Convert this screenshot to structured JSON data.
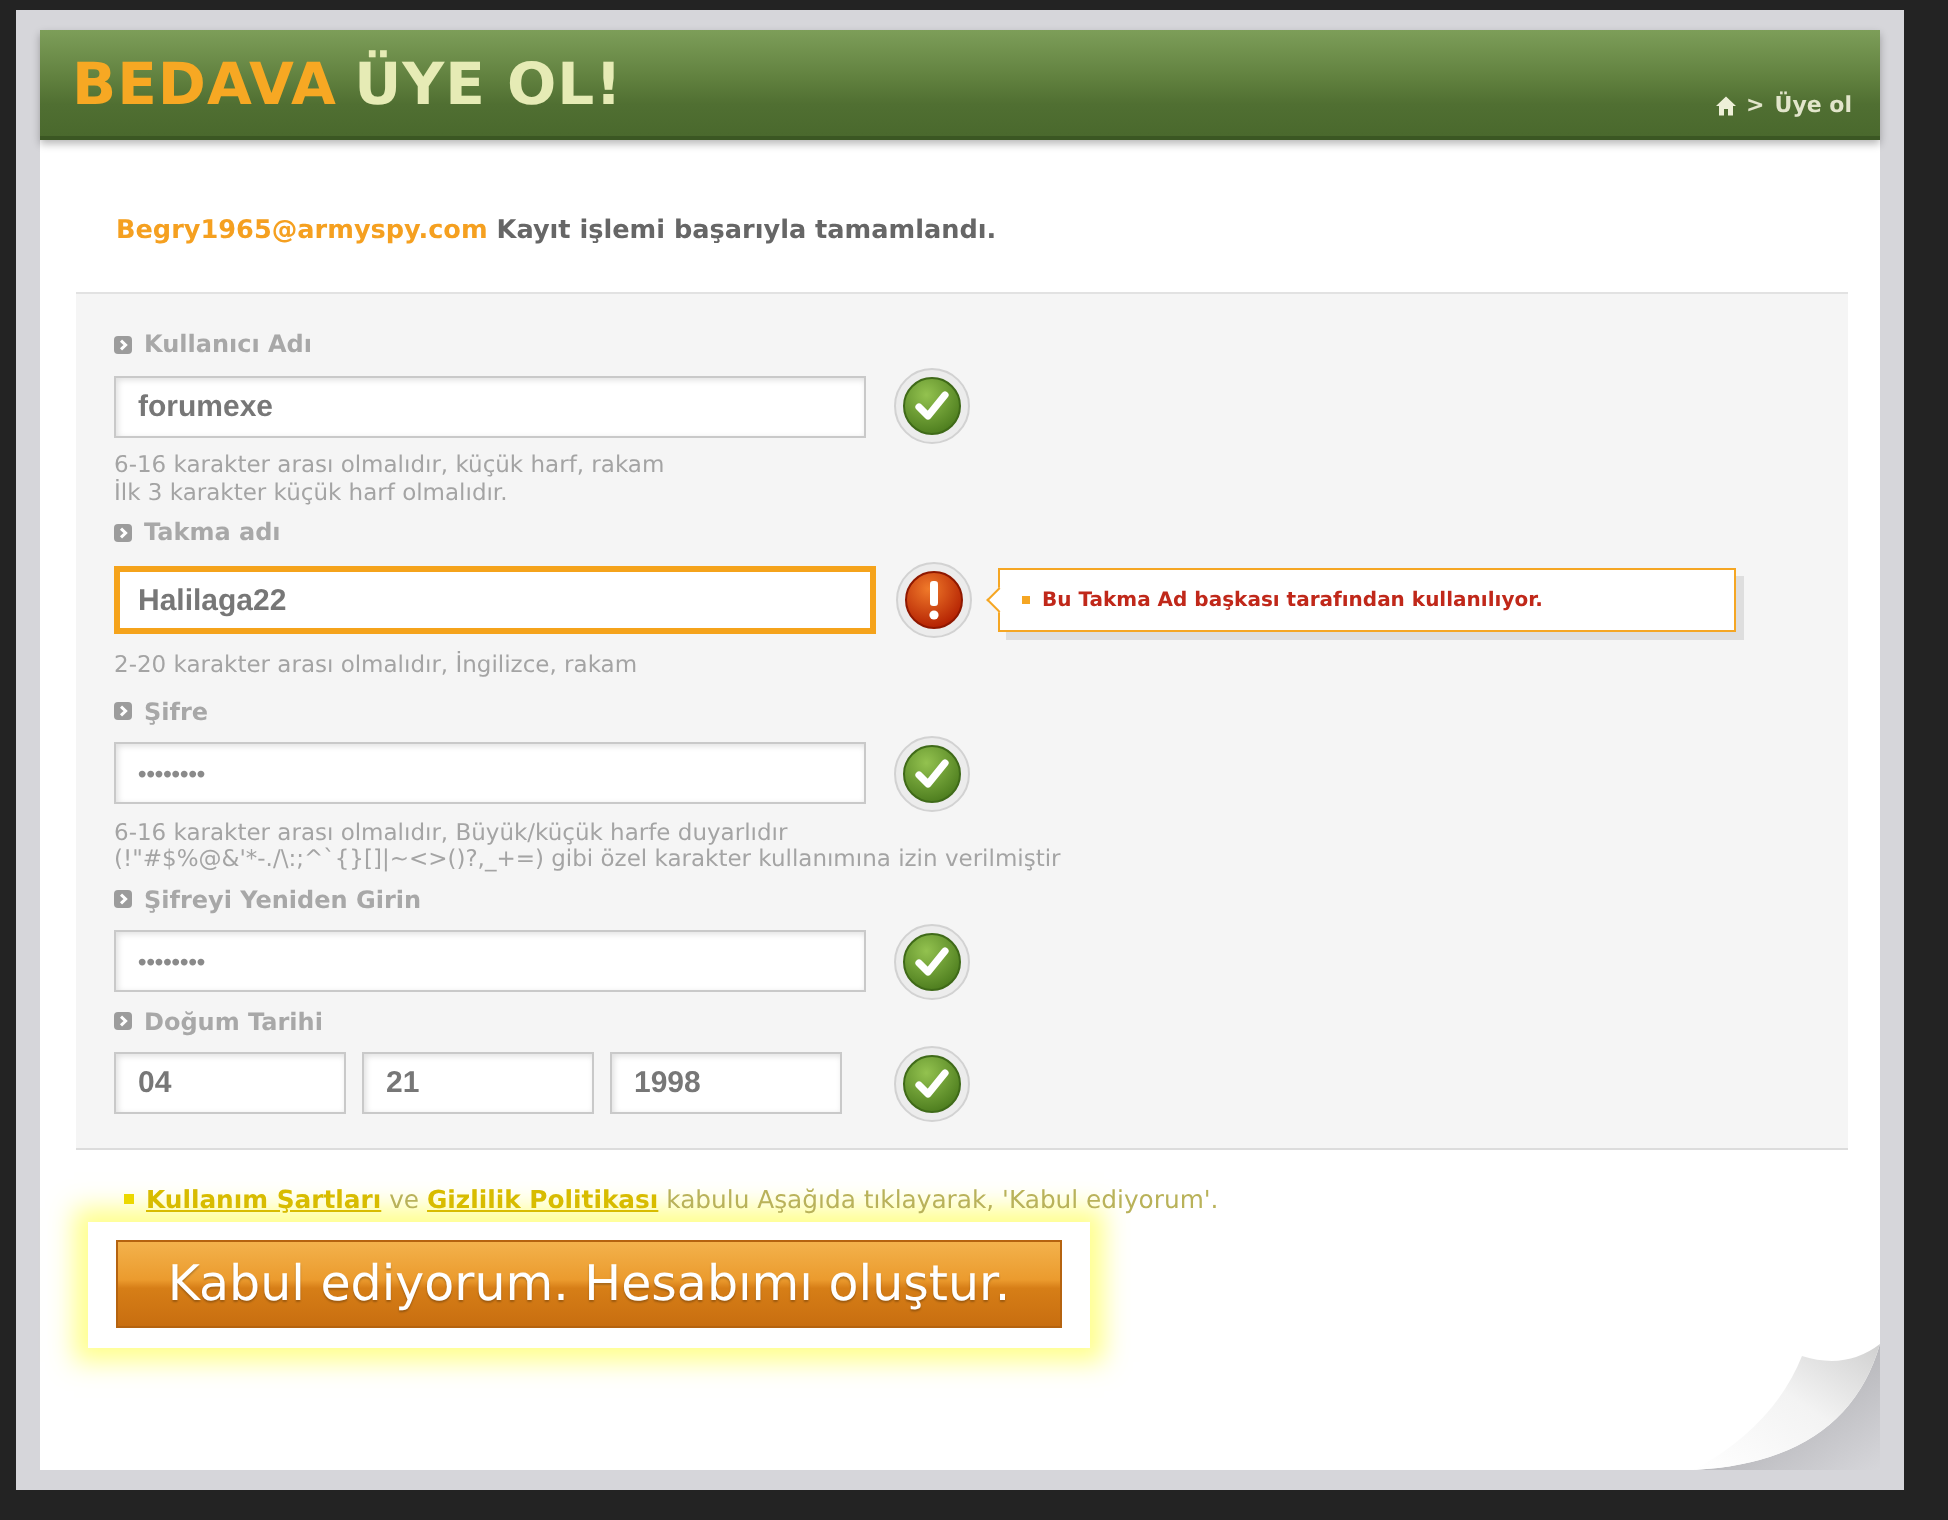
{
  "header": {
    "title": [
      {
        "text": "BEDAVA",
        "kind": "accent"
      },
      {
        "text": "ÜYE OL!",
        "kind": "plain"
      }
    ],
    "breadcrumb": {
      "separator": ">",
      "current": "Üye ol"
    }
  },
  "notice": {
    "email": "Begry1965@armyspy.com",
    "message": "Kayıt işlemi başarıyla tamamlandı."
  },
  "fields": [
    {
      "kind": "text",
      "label": "Kullanıcı Adı",
      "value": "forumexe",
      "valid": true,
      "hints": [
        "6-16 karakter arası olmalıdır, küçük harf, rakam",
        "İlk 3 karakter küçük harf olmalıdır."
      ]
    },
    {
      "kind": "text",
      "label": "Takma adı",
      "value": "Halilaga22",
      "valid": false,
      "error": "Bu Takma Ad başkası tarafından kullanılıyor.",
      "hints": [
        "2-20 karakter arası olmalıdır, İngilizce, rakam"
      ]
    },
    {
      "kind": "password",
      "label": "Şifre",
      "value": "••••••••",
      "valid": true,
      "hints": [
        "6-16 karakter arası olmalıdır, Büyük/küçük harfe duyarlıdır",
        "(!\"#$%@&'*-./\\:;^`{}[]|~<>()?,_+=) gibi özel karakter kullanımına izin verilmiştir"
      ]
    },
    {
      "kind": "password",
      "label": "Şifreyi Yeniden Girin",
      "value": "••••••••",
      "valid": true
    },
    {
      "kind": "date",
      "label": "Doğum Tarihi",
      "values": [
        "04",
        "21",
        "1998"
      ],
      "valid": true
    }
  ],
  "terms": [
    {
      "kind": "link",
      "text": "Kullanım Şartları"
    },
    {
      "kind": "text",
      "text": "ve"
    },
    {
      "kind": "link",
      "text": "Gizlilik Politikası"
    },
    {
      "kind": "text",
      "text": "kabulu Aşağıda tıklayarak, 'Kabul ediyorum'."
    }
  ],
  "submit_button": {
    "label": "Kabul ediyorum. Hesabımı oluştur."
  }
}
